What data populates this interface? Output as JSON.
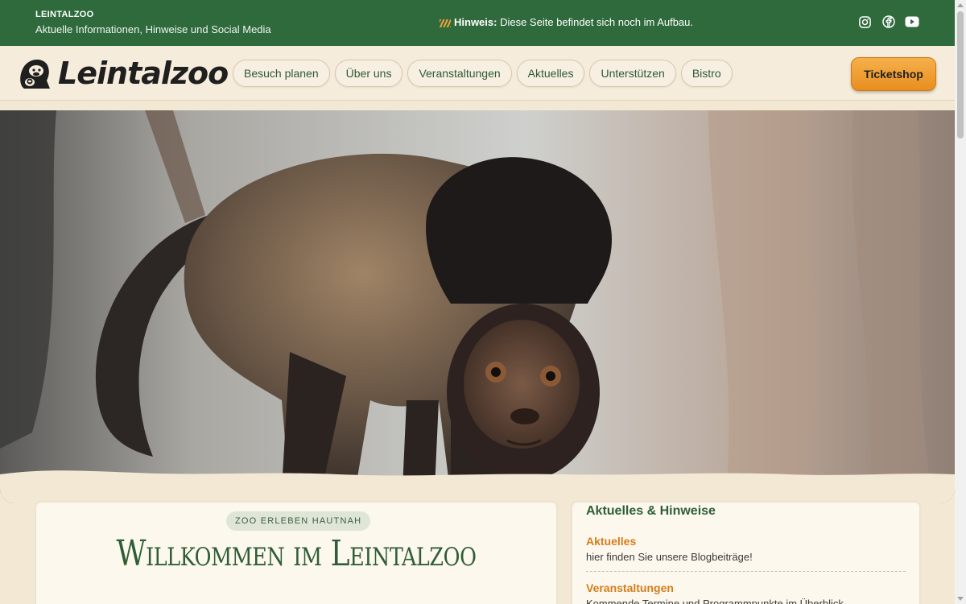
{
  "topbar": {
    "brand": "LEINTALZOO",
    "subtitle": "Aktuelle Informationen, Hinweise und Social Media",
    "notice_label": "Hinweis:",
    "notice_text": " Diese Seite befindet sich noch im Aufbau.",
    "social": [
      "instagram-icon",
      "facebook-icon",
      "youtube-icon"
    ],
    "bg_color": "#2f6a3c"
  },
  "header": {
    "logo_text": "Leintalzoo",
    "nav": [
      "Besuch planen",
      "Über uns",
      "Veranstaltungen",
      "Aktuelles",
      "Unterstützen",
      "Bistro"
    ],
    "ticket_label": "Ticketshop",
    "accent_color": "#f0a13a"
  },
  "hero": {
    "image": "capuchin-monkey-photo"
  },
  "intro": {
    "badge": "ZOO ERLEBEN HAUTNAH",
    "title": "Willkommen im Leintalzoo"
  },
  "news": {
    "heading": "Aktuelles & Hinweise",
    "items": [
      {
        "title": "Aktuelles",
        "text": "hier finden Sie unsere Blogbeiträge!"
      },
      {
        "title": "Veranstaltungen",
        "text": "Kommende Termine und Programmpunkte im Überblick"
      }
    ]
  }
}
